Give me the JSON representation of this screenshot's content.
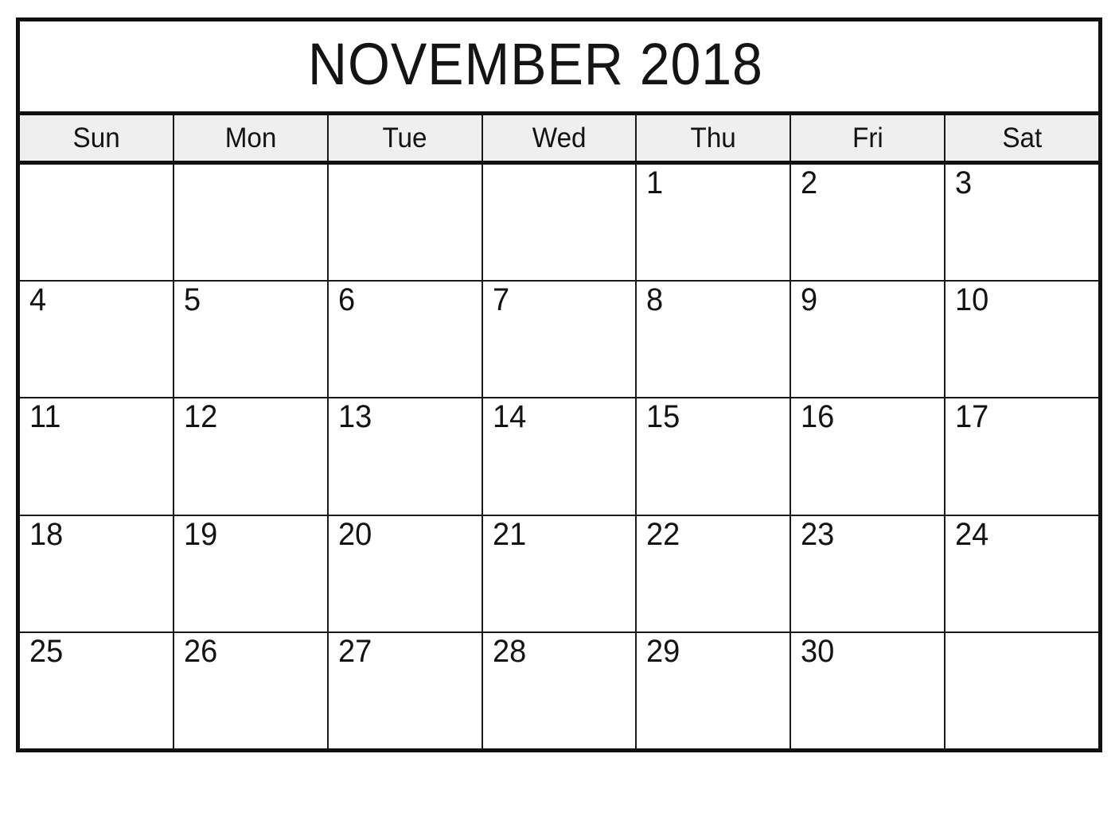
{
  "calendar": {
    "title": "NOVEMBER 2018",
    "month": "November",
    "year": "2018",
    "colors": {
      "border": "#111111",
      "grid_line": "#1a1a1a",
      "header_background": "#efefef",
      "cell_background": "#ffffff",
      "text": "#131313"
    },
    "weekdays": [
      {
        "label": "Sun"
      },
      {
        "label": "Mon"
      },
      {
        "label": "Tue"
      },
      {
        "label": "Wed"
      },
      {
        "label": "Thu"
      },
      {
        "label": "Fri"
      },
      {
        "label": "Sat"
      }
    ],
    "weeks": [
      [
        {
          "day": ""
        },
        {
          "day": ""
        },
        {
          "day": ""
        },
        {
          "day": ""
        },
        {
          "day": "1"
        },
        {
          "day": "2"
        },
        {
          "day": "3"
        }
      ],
      [
        {
          "day": "4"
        },
        {
          "day": "5"
        },
        {
          "day": "6"
        },
        {
          "day": "7"
        },
        {
          "day": "8"
        },
        {
          "day": "9"
        },
        {
          "day": "10"
        }
      ],
      [
        {
          "day": "11"
        },
        {
          "day": "12"
        },
        {
          "day": "13"
        },
        {
          "day": "14"
        },
        {
          "day": "15"
        },
        {
          "day": "16"
        },
        {
          "day": "17"
        }
      ],
      [
        {
          "day": "18"
        },
        {
          "day": "19"
        },
        {
          "day": "20"
        },
        {
          "day": "21"
        },
        {
          "day": "22"
        },
        {
          "day": "23"
        },
        {
          "day": "24"
        }
      ],
      [
        {
          "day": "25"
        },
        {
          "day": "26"
        },
        {
          "day": "27"
        },
        {
          "day": "28"
        },
        {
          "day": "29"
        },
        {
          "day": "30"
        },
        {
          "day": ""
        }
      ]
    ]
  }
}
